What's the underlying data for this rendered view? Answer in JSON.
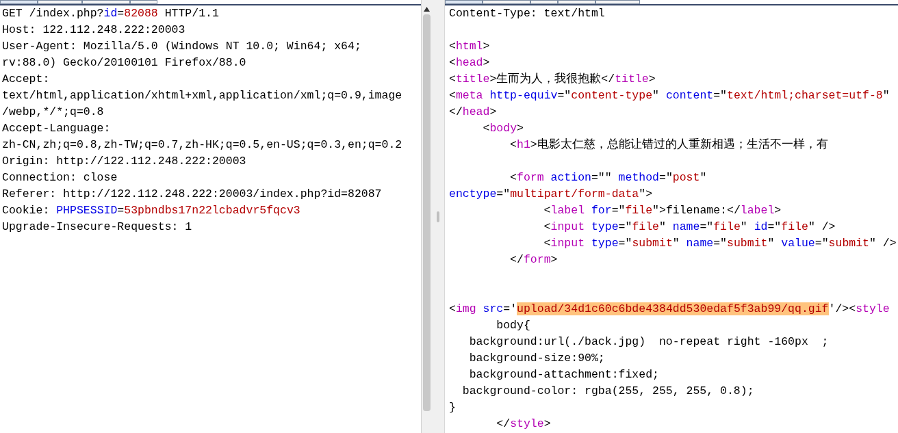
{
  "request": {
    "lines": [
      {
        "kind": "text",
        "segments": [
          {
            "kind": "plain",
            "text": "GET /index.php?"
          },
          {
            "kind": "name",
            "text": "id"
          },
          {
            "kind": "plain",
            "text": "="
          },
          {
            "kind": "value",
            "text": "82088"
          },
          {
            "kind": "plain",
            "text": " HTTP/1.1"
          }
        ]
      },
      {
        "kind": "text",
        "segments": [
          {
            "kind": "plain",
            "text": "Host: 122.112.248.222:20003"
          }
        ]
      },
      {
        "kind": "text",
        "segments": [
          {
            "kind": "plain",
            "text": "User-Agent: Mozilla/5.0 (Windows NT 10.0; Win64; x64;"
          }
        ]
      },
      {
        "kind": "text",
        "segments": [
          {
            "kind": "plain",
            "text": "rv:88.0) Gecko/20100101 Firefox/88.0"
          }
        ]
      },
      {
        "kind": "text",
        "segments": [
          {
            "kind": "plain",
            "text": "Accept:"
          }
        ]
      },
      {
        "kind": "text",
        "segments": [
          {
            "kind": "plain",
            "text": "text/html,application/xhtml+xml,application/xml;q=0.9,image"
          }
        ]
      },
      {
        "kind": "text",
        "segments": [
          {
            "kind": "plain",
            "text": "/webp,*/*;q=0.8"
          }
        ]
      },
      {
        "kind": "text",
        "segments": [
          {
            "kind": "plain",
            "text": "Accept-Language:"
          }
        ]
      },
      {
        "kind": "text",
        "segments": [
          {
            "kind": "plain",
            "text": "zh-CN,zh;q=0.8,zh-TW;q=0.7,zh-HK;q=0.5,en-US;q=0.3,en;q=0.2"
          }
        ]
      },
      {
        "kind": "text",
        "segments": [
          {
            "kind": "plain",
            "text": "Origin: http://122.112.248.222:20003"
          }
        ]
      },
      {
        "kind": "text",
        "segments": [
          {
            "kind": "plain",
            "text": "Connection: close"
          }
        ]
      },
      {
        "kind": "text",
        "segments": [
          {
            "kind": "plain",
            "text": "Referer: http://122.112.248.222:20003/index.php?id=82087"
          }
        ]
      },
      {
        "kind": "text",
        "segments": [
          {
            "kind": "plain",
            "text": "Cookie: "
          },
          {
            "kind": "name",
            "text": "PHPSESSID"
          },
          {
            "kind": "plain",
            "text": "="
          },
          {
            "kind": "value",
            "text": "53pbndbs17n22lcbadvr5fqcv3"
          }
        ]
      },
      {
        "kind": "text",
        "segments": [
          {
            "kind": "plain",
            "text": "Upgrade-Insecure-Requests: 1"
          }
        ]
      }
    ]
  },
  "response": {
    "lines": [
      {
        "kind": "text",
        "segments": [
          {
            "kind": "plain",
            "text": "Content-Type: text/html"
          }
        ]
      },
      {
        "kind": "blank"
      },
      {
        "kind": "text",
        "segments": [
          {
            "kind": "plain",
            "text": "<"
          },
          {
            "kind": "tag",
            "text": "html"
          },
          {
            "kind": "plain",
            "text": ">"
          }
        ]
      },
      {
        "kind": "text",
        "segments": [
          {
            "kind": "plain",
            "text": "<"
          },
          {
            "kind": "tag",
            "text": "head"
          },
          {
            "kind": "plain",
            "text": ">"
          }
        ]
      },
      {
        "kind": "text",
        "segments": [
          {
            "kind": "plain",
            "text": "<"
          },
          {
            "kind": "tag",
            "text": "title"
          },
          {
            "kind": "plain",
            "text": ">生而为人，我很抱歉</"
          },
          {
            "kind": "tag",
            "text": "title"
          },
          {
            "kind": "plain",
            "text": ">"
          }
        ]
      },
      {
        "kind": "text",
        "segments": [
          {
            "kind": "plain",
            "text": "<"
          },
          {
            "kind": "tag",
            "text": "meta"
          },
          {
            "kind": "name",
            "text": " http-equiv"
          },
          {
            "kind": "plain",
            "text": "=\""
          },
          {
            "kind": "value",
            "text": "content-type"
          },
          {
            "kind": "plain",
            "text": "\""
          },
          {
            "kind": "name",
            "text": " content"
          },
          {
            "kind": "plain",
            "text": "=\""
          },
          {
            "kind": "value",
            "text": "text/html;charset=utf-8"
          },
          {
            "kind": "plain",
            "text": "\""
          }
        ]
      },
      {
        "kind": "text",
        "segments": [
          {
            "kind": "plain",
            "text": "</"
          },
          {
            "kind": "tag",
            "text": "head"
          },
          {
            "kind": "plain",
            "text": ">"
          }
        ]
      },
      {
        "kind": "text",
        "segments": [
          {
            "kind": "plain",
            "text": "     <"
          },
          {
            "kind": "tag",
            "text": "body"
          },
          {
            "kind": "plain",
            "text": ">"
          }
        ]
      },
      {
        "kind": "text",
        "segments": [
          {
            "kind": "plain",
            "text": "         <"
          },
          {
            "kind": "tag",
            "text": "h1"
          },
          {
            "kind": "plain",
            "text": ">电影太仁慈，总能让错过的人重新相遇；生活不一样，有"
          }
        ]
      },
      {
        "kind": "blank"
      },
      {
        "kind": "text",
        "segments": [
          {
            "kind": "plain",
            "text": "         <"
          },
          {
            "kind": "tag",
            "text": "form"
          },
          {
            "kind": "name",
            "text": " action"
          },
          {
            "kind": "plain",
            "text": "=\"\""
          },
          {
            "kind": "name",
            "text": " method"
          },
          {
            "kind": "plain",
            "text": "=\""
          },
          {
            "kind": "value",
            "text": "post"
          },
          {
            "kind": "plain",
            "text": "\""
          }
        ]
      },
      {
        "kind": "text",
        "segments": [
          {
            "kind": "name",
            "text": "enctype"
          },
          {
            "kind": "plain",
            "text": "=\""
          },
          {
            "kind": "value",
            "text": "multipart/form-data"
          },
          {
            "kind": "plain",
            "text": "\">"
          }
        ]
      },
      {
        "kind": "text",
        "segments": [
          {
            "kind": "plain",
            "text": "              <"
          },
          {
            "kind": "tag",
            "text": "label"
          },
          {
            "kind": "name",
            "text": " for"
          },
          {
            "kind": "plain",
            "text": "=\""
          },
          {
            "kind": "value",
            "text": "file"
          },
          {
            "kind": "plain",
            "text": "\">filename:</"
          },
          {
            "kind": "tag",
            "text": "label"
          },
          {
            "kind": "plain",
            "text": ">"
          }
        ]
      },
      {
        "kind": "text",
        "segments": [
          {
            "kind": "plain",
            "text": "              <"
          },
          {
            "kind": "tag",
            "text": "input"
          },
          {
            "kind": "name",
            "text": " type"
          },
          {
            "kind": "plain",
            "text": "=\""
          },
          {
            "kind": "value",
            "text": "file"
          },
          {
            "kind": "plain",
            "text": "\""
          },
          {
            "kind": "name",
            "text": " name"
          },
          {
            "kind": "plain",
            "text": "=\""
          },
          {
            "kind": "value",
            "text": "file"
          },
          {
            "kind": "plain",
            "text": "\""
          },
          {
            "kind": "name",
            "text": " id"
          },
          {
            "kind": "plain",
            "text": "=\""
          },
          {
            "kind": "value",
            "text": "file"
          },
          {
            "kind": "plain",
            "text": "\" />"
          }
        ]
      },
      {
        "kind": "text",
        "segments": [
          {
            "kind": "plain",
            "text": "              <"
          },
          {
            "kind": "tag",
            "text": "input"
          },
          {
            "kind": "name",
            "text": " type"
          },
          {
            "kind": "plain",
            "text": "=\""
          },
          {
            "kind": "value",
            "text": "submit"
          },
          {
            "kind": "plain",
            "text": "\""
          },
          {
            "kind": "name",
            "text": " name"
          },
          {
            "kind": "plain",
            "text": "=\""
          },
          {
            "kind": "value",
            "text": "submit"
          },
          {
            "kind": "plain",
            "text": "\""
          },
          {
            "kind": "name",
            "text": " value"
          },
          {
            "kind": "plain",
            "text": "=\""
          },
          {
            "kind": "value",
            "text": "submit"
          },
          {
            "kind": "plain",
            "text": "\" />"
          }
        ]
      },
      {
        "kind": "text",
        "segments": [
          {
            "kind": "plain",
            "text": "         </"
          },
          {
            "kind": "tag",
            "text": "form"
          },
          {
            "kind": "plain",
            "text": ">"
          }
        ]
      },
      {
        "kind": "blank"
      },
      {
        "kind": "blank"
      },
      {
        "kind": "text",
        "segments": [
          {
            "kind": "plain",
            "text": "<"
          },
          {
            "kind": "tag",
            "text": "img"
          },
          {
            "kind": "name",
            "text": " src"
          },
          {
            "kind": "plain",
            "text": "='"
          },
          {
            "kind": "selected",
            "text": "upload/34d1c60c6bde4384dd530edaf5f3ab99/qq.gif"
          },
          {
            "kind": "plain",
            "text": "'/><"
          },
          {
            "kind": "tag",
            "text": "style"
          }
        ]
      },
      {
        "kind": "text",
        "segments": [
          {
            "kind": "plain",
            "text": "       body{"
          }
        ]
      },
      {
        "kind": "text",
        "segments": [
          {
            "kind": "plain",
            "text": "   background:url(./back.jpg)  no-repeat right -160px  ;"
          }
        ]
      },
      {
        "kind": "text",
        "segments": [
          {
            "kind": "plain",
            "text": "   background-size:90%;"
          }
        ]
      },
      {
        "kind": "text",
        "segments": [
          {
            "kind": "plain",
            "text": "   background-attachment:fixed;"
          }
        ]
      },
      {
        "kind": "text",
        "segments": [
          {
            "kind": "plain",
            "text": "  background-color: rgba(255, 255, 255, 0.8);"
          }
        ]
      },
      {
        "kind": "text",
        "segments": [
          {
            "kind": "plain",
            "text": "}"
          }
        ]
      },
      {
        "kind": "text",
        "segments": [
          {
            "kind": "plain",
            "text": "       </"
          },
          {
            "kind": "tag",
            "text": "style"
          },
          {
            "kind": "plain",
            "text": ">"
          }
        ]
      }
    ]
  }
}
